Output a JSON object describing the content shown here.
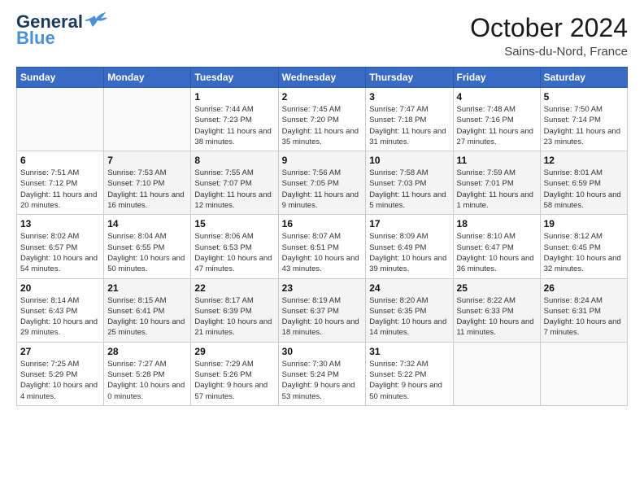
{
  "header": {
    "logo_line1": "General",
    "logo_line2": "Blue",
    "month": "October 2024",
    "location": "Sains-du-Nord, France"
  },
  "days_of_week": [
    "Sunday",
    "Monday",
    "Tuesday",
    "Wednesday",
    "Thursday",
    "Friday",
    "Saturday"
  ],
  "weeks": [
    [
      {
        "num": "",
        "sunrise": "",
        "sunset": "",
        "daylight": ""
      },
      {
        "num": "",
        "sunrise": "",
        "sunset": "",
        "daylight": ""
      },
      {
        "num": "1",
        "sunrise": "Sunrise: 7:44 AM",
        "sunset": "Sunset: 7:23 PM",
        "daylight": "Daylight: 11 hours and 38 minutes."
      },
      {
        "num": "2",
        "sunrise": "Sunrise: 7:45 AM",
        "sunset": "Sunset: 7:20 PM",
        "daylight": "Daylight: 11 hours and 35 minutes."
      },
      {
        "num": "3",
        "sunrise": "Sunrise: 7:47 AM",
        "sunset": "Sunset: 7:18 PM",
        "daylight": "Daylight: 11 hours and 31 minutes."
      },
      {
        "num": "4",
        "sunrise": "Sunrise: 7:48 AM",
        "sunset": "Sunset: 7:16 PM",
        "daylight": "Daylight: 11 hours and 27 minutes."
      },
      {
        "num": "5",
        "sunrise": "Sunrise: 7:50 AM",
        "sunset": "Sunset: 7:14 PM",
        "daylight": "Daylight: 11 hours and 23 minutes."
      }
    ],
    [
      {
        "num": "6",
        "sunrise": "Sunrise: 7:51 AM",
        "sunset": "Sunset: 7:12 PM",
        "daylight": "Daylight: 11 hours and 20 minutes."
      },
      {
        "num": "7",
        "sunrise": "Sunrise: 7:53 AM",
        "sunset": "Sunset: 7:10 PM",
        "daylight": "Daylight: 11 hours and 16 minutes."
      },
      {
        "num": "8",
        "sunrise": "Sunrise: 7:55 AM",
        "sunset": "Sunset: 7:07 PM",
        "daylight": "Daylight: 11 hours and 12 minutes."
      },
      {
        "num": "9",
        "sunrise": "Sunrise: 7:56 AM",
        "sunset": "Sunset: 7:05 PM",
        "daylight": "Daylight: 11 hours and 9 minutes."
      },
      {
        "num": "10",
        "sunrise": "Sunrise: 7:58 AM",
        "sunset": "Sunset: 7:03 PM",
        "daylight": "Daylight: 11 hours and 5 minutes."
      },
      {
        "num": "11",
        "sunrise": "Sunrise: 7:59 AM",
        "sunset": "Sunset: 7:01 PM",
        "daylight": "Daylight: 11 hours and 1 minute."
      },
      {
        "num": "12",
        "sunrise": "Sunrise: 8:01 AM",
        "sunset": "Sunset: 6:59 PM",
        "daylight": "Daylight: 10 hours and 58 minutes."
      }
    ],
    [
      {
        "num": "13",
        "sunrise": "Sunrise: 8:02 AM",
        "sunset": "Sunset: 6:57 PM",
        "daylight": "Daylight: 10 hours and 54 minutes."
      },
      {
        "num": "14",
        "sunrise": "Sunrise: 8:04 AM",
        "sunset": "Sunset: 6:55 PM",
        "daylight": "Daylight: 10 hours and 50 minutes."
      },
      {
        "num": "15",
        "sunrise": "Sunrise: 8:06 AM",
        "sunset": "Sunset: 6:53 PM",
        "daylight": "Daylight: 10 hours and 47 minutes."
      },
      {
        "num": "16",
        "sunrise": "Sunrise: 8:07 AM",
        "sunset": "Sunset: 6:51 PM",
        "daylight": "Daylight: 10 hours and 43 minutes."
      },
      {
        "num": "17",
        "sunrise": "Sunrise: 8:09 AM",
        "sunset": "Sunset: 6:49 PM",
        "daylight": "Daylight: 10 hours and 39 minutes."
      },
      {
        "num": "18",
        "sunrise": "Sunrise: 8:10 AM",
        "sunset": "Sunset: 6:47 PM",
        "daylight": "Daylight: 10 hours and 36 minutes."
      },
      {
        "num": "19",
        "sunrise": "Sunrise: 8:12 AM",
        "sunset": "Sunset: 6:45 PM",
        "daylight": "Daylight: 10 hours and 32 minutes."
      }
    ],
    [
      {
        "num": "20",
        "sunrise": "Sunrise: 8:14 AM",
        "sunset": "Sunset: 6:43 PM",
        "daylight": "Daylight: 10 hours and 29 minutes."
      },
      {
        "num": "21",
        "sunrise": "Sunrise: 8:15 AM",
        "sunset": "Sunset: 6:41 PM",
        "daylight": "Daylight: 10 hours and 25 minutes."
      },
      {
        "num": "22",
        "sunrise": "Sunrise: 8:17 AM",
        "sunset": "Sunset: 6:39 PM",
        "daylight": "Daylight: 10 hours and 21 minutes."
      },
      {
        "num": "23",
        "sunrise": "Sunrise: 8:19 AM",
        "sunset": "Sunset: 6:37 PM",
        "daylight": "Daylight: 10 hours and 18 minutes."
      },
      {
        "num": "24",
        "sunrise": "Sunrise: 8:20 AM",
        "sunset": "Sunset: 6:35 PM",
        "daylight": "Daylight: 10 hours and 14 minutes."
      },
      {
        "num": "25",
        "sunrise": "Sunrise: 8:22 AM",
        "sunset": "Sunset: 6:33 PM",
        "daylight": "Daylight: 10 hours and 11 minutes."
      },
      {
        "num": "26",
        "sunrise": "Sunrise: 8:24 AM",
        "sunset": "Sunset: 6:31 PM",
        "daylight": "Daylight: 10 hours and 7 minutes."
      }
    ],
    [
      {
        "num": "27",
        "sunrise": "Sunrise: 7:25 AM",
        "sunset": "Sunset: 5:29 PM",
        "daylight": "Daylight: 10 hours and 4 minutes."
      },
      {
        "num": "28",
        "sunrise": "Sunrise: 7:27 AM",
        "sunset": "Sunset: 5:28 PM",
        "daylight": "Daylight: 10 hours and 0 minutes."
      },
      {
        "num": "29",
        "sunrise": "Sunrise: 7:29 AM",
        "sunset": "Sunset: 5:26 PM",
        "daylight": "Daylight: 9 hours and 57 minutes."
      },
      {
        "num": "30",
        "sunrise": "Sunrise: 7:30 AM",
        "sunset": "Sunset: 5:24 PM",
        "daylight": "Daylight: 9 hours and 53 minutes."
      },
      {
        "num": "31",
        "sunrise": "Sunrise: 7:32 AM",
        "sunset": "Sunset: 5:22 PM",
        "daylight": "Daylight: 9 hours and 50 minutes."
      },
      {
        "num": "",
        "sunrise": "",
        "sunset": "",
        "daylight": ""
      },
      {
        "num": "",
        "sunrise": "",
        "sunset": "",
        "daylight": ""
      }
    ]
  ]
}
